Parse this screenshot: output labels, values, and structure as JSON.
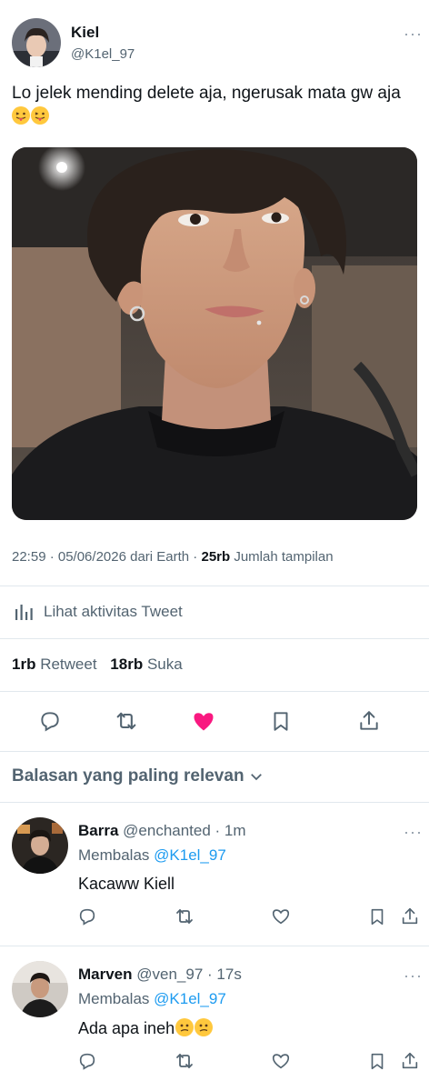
{
  "tweet": {
    "author_name": "Kiel",
    "author_handle": "@K1el_97",
    "text": "Lo jelek mending delete aja, ngerusak mata gw aja",
    "meta_time": "22:59 · 05/06/2026 dari Earth · ",
    "views_count": "25rb",
    "views_label": " Jumlah tampilan",
    "activity_label": "Lihat aktivitas Tweet",
    "retweets_count": "1rb",
    "retweets_label": " Retweet",
    "likes_count": "18rb",
    "likes_label": " Suka",
    "liked": true
  },
  "replies_section": {
    "sort_label": "Balasan yang paling relevan"
  },
  "replies": [
    {
      "name": "Barra",
      "handle": "@enchanted",
      "time": " · 1m",
      "replying_prefix": "Membalas ",
      "replying_handle": "@K1el_97",
      "text": "Kacaww Kiell"
    },
    {
      "name": "Marven",
      "handle": "@ven_97",
      "time": " · 17s",
      "replying_prefix": "Membalas ",
      "replying_handle": "@K1el_97",
      "text": "Ada apa ineh"
    }
  ],
  "colors": {
    "like_active": "#f91880",
    "link": "#1d9bf0",
    "muted": "#536471"
  },
  "icons": [
    "more-icon",
    "chart-icon",
    "reply-icon",
    "retweet-icon",
    "heart-icon",
    "bookmark-icon",
    "share-icon",
    "chevron-down-icon"
  ]
}
